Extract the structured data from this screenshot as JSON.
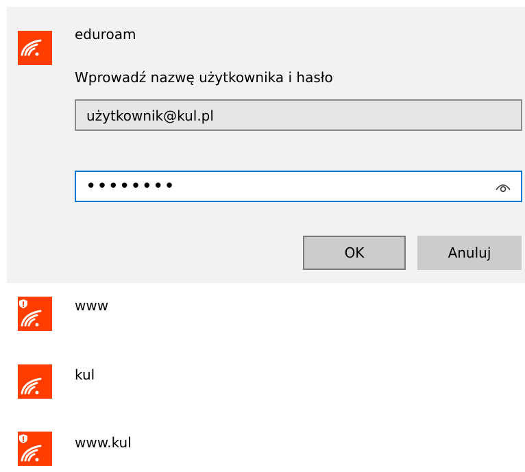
{
  "theme": {
    "accent": "#ff3d00",
    "focus": "#0078d7",
    "panel_bg": "#f2f2f2"
  },
  "connect_panel": {
    "network_name": "eduroam",
    "network_icon": "wifi-icon",
    "prompt": "Wprowadź nazwę użytkownika i hasło",
    "username_value": "użytkownik@kul.pl",
    "password_masked": "••••••••",
    "reveal_icon": "eye-icon",
    "ok_label": "OK",
    "cancel_label": "Anuluj"
  },
  "networks": [
    {
      "name": "www",
      "icon": "wifi-shield-icon",
      "secured_warning": true
    },
    {
      "name": "kul",
      "icon": "wifi-icon",
      "secured_warning": false
    },
    {
      "name": "www.kul",
      "icon": "wifi-shield-icon",
      "secured_warning": true
    }
  ]
}
